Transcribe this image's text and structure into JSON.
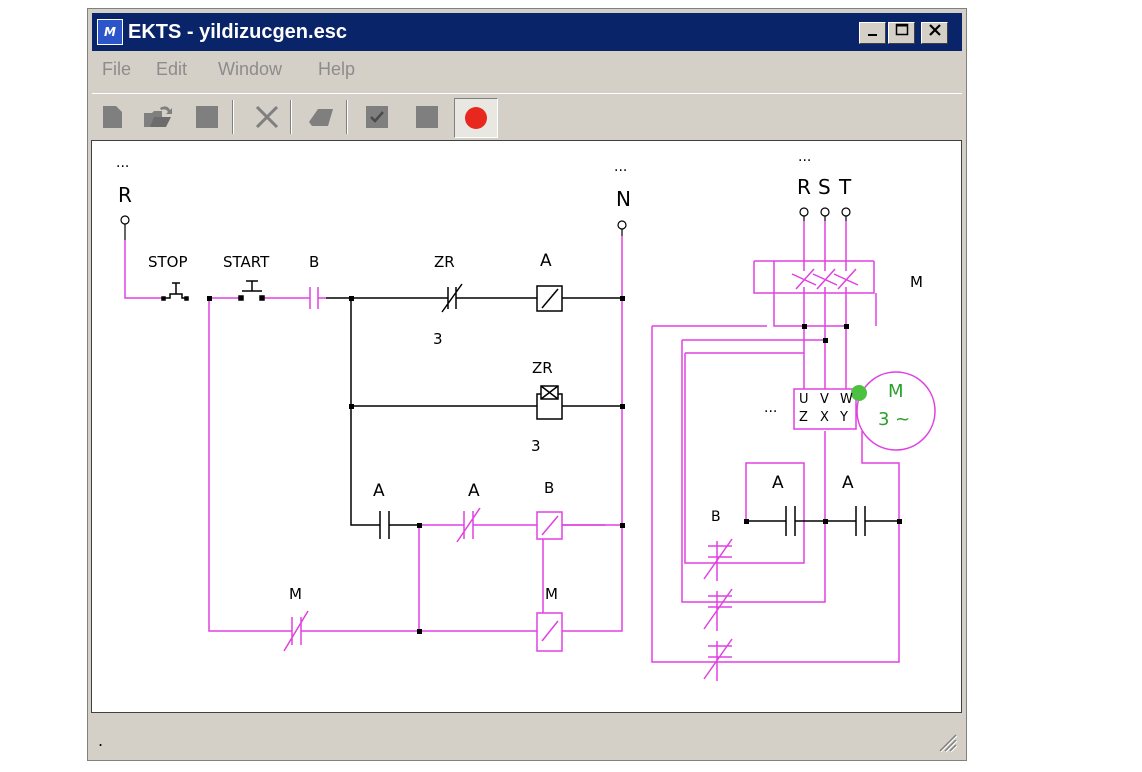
{
  "window": {
    "title": "EKTS - yildizucgen.esc",
    "app_icon": "ekts-logo-icon",
    "controls": [
      "minimize-icon",
      "maximize-icon",
      "close-icon"
    ]
  },
  "menu": [
    "File",
    "Edit",
    "Window",
    "Help"
  ],
  "toolbar": [
    {
      "name": "new-file-icon"
    },
    {
      "name": "open-file-icon"
    },
    {
      "name": "save-file-icon"
    },
    {
      "name": "delete-icon"
    },
    {
      "name": "eraser-icon"
    },
    {
      "name": "check-icon"
    },
    {
      "name": "stop-icon"
    },
    {
      "name": "record-icon",
      "pressed": true,
      "color": "#e8281e"
    }
  ],
  "colors": {
    "active_wire": "#e040e0",
    "inactive_wire": "#000000",
    "motor": "#2aa02a",
    "indicator": "#4cc040",
    "record": "#e8281e"
  },
  "circuit": {
    "labels": {
      "r_dots": "...",
      "r": "R",
      "n_dots": "...",
      "n": "N",
      "stop": "STOP",
      "start": "START",
      "b1": "B",
      "zr1": "ZR",
      "zr1_value": "3",
      "a1": "A",
      "zr2": "ZR",
      "zr2_value": "3",
      "a2": "A",
      "a3": "A",
      "b2": "B",
      "m1": "M",
      "m2": "M",
      "rst_dots": "...",
      "r2": "R",
      "s": "S",
      "t": "T",
      "contactor_m": "M",
      "term_u": "U",
      "term_v": "V",
      "term_w": "W",
      "term_z": "Z",
      "term_x": "X",
      "term_y": "Y",
      "term_dots": "...",
      "motor_m": "M",
      "motor_phase": "3 ~",
      "a4": "A",
      "a5": "A",
      "b3": "B"
    }
  },
  "status": {
    "text": "."
  }
}
